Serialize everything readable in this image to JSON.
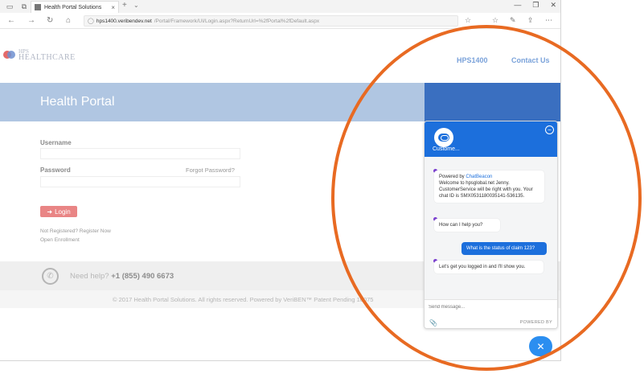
{
  "browser": {
    "tab_title": "Health Portal Solutions",
    "url_host": "hps1400.veribendev.net",
    "url_path": "/Portal/Framework/UI/Login.aspx?ReturnUrl=%2fPortal%2fDefault.aspx",
    "nav": {
      "back": "←",
      "forward": "→",
      "refresh": "↻",
      "home": "⌂"
    },
    "new_tab": "+",
    "tab_close": "×",
    "tab_dropdown": "⌄",
    "window_controls": {
      "minimize": "—",
      "maximize": "❐",
      "close": "✕"
    }
  },
  "site": {
    "logo": {
      "small": "HPS",
      "big": "HEALTHCARE"
    },
    "links": {
      "hps": "HPS1400",
      "contact": "Contact Us"
    },
    "hero_title": "Health Portal"
  },
  "login": {
    "username_label": "Username",
    "password_label": "Password",
    "forgot_link": "Forgot Password?",
    "login_button": "Login",
    "login_icon": "➜",
    "register_text": "Not Registered? Register Now",
    "open_enrollment": "Open Enrollment"
  },
  "help": {
    "question": "Need help?",
    "phone": "+1 (855) 490 6673",
    "phone_icon": "✆"
  },
  "footer": {
    "text": "© 2017 Health Portal Solutions. All rights reserved.    Powered by VeriBEN™  Patent Pending 10075"
  },
  "chat": {
    "header_name": "Custome...",
    "minimize_icon": "−",
    "messages": [
      {
        "powered_prefix": "Powered by ",
        "brand": "ChatBeacon",
        "body": "Welcome to hpsglobal.net Jenny. CustomerService will be right with you. Your chat ID is SMX0531180035141-536135."
      },
      {
        "body": "How can I help you?"
      },
      {
        "body": "What is the status of claim 123?"
      },
      {
        "body": "Let's get you logged in and I'll show you."
      }
    ],
    "input_placeholder": "Send message...",
    "powered_by": "POWERED BY",
    "attach_icon": "📎",
    "close_icon": "✕"
  },
  "colors": {
    "accent_blue": "#1c6fdc",
    "highlight_orange": "#e86a22",
    "login_button": "#e98585"
  }
}
